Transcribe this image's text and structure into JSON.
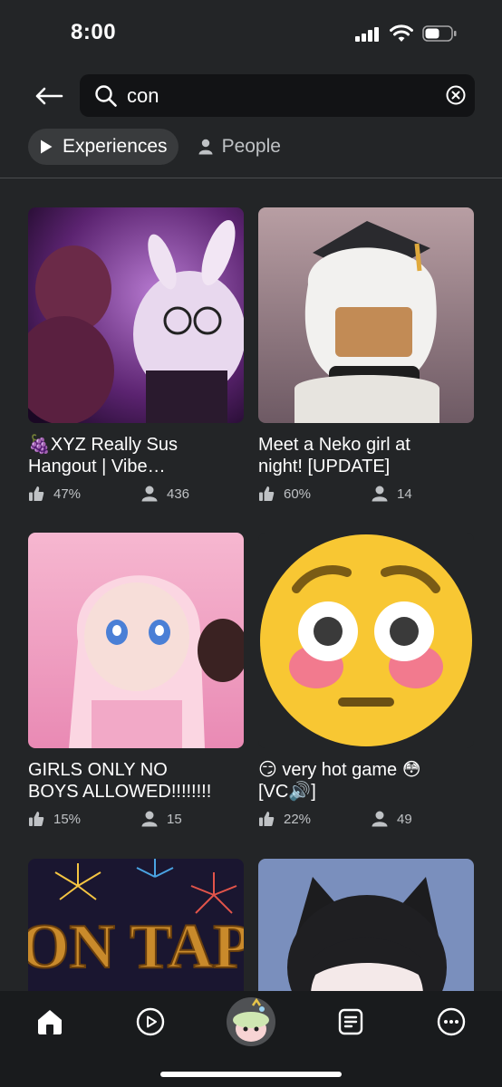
{
  "status_bar": {
    "time": "8:00",
    "icons": [
      "signal-icon",
      "wifi-icon",
      "battery-icon"
    ]
  },
  "search": {
    "value": "con",
    "back_icon": "arrow-left-icon",
    "search_icon": "search-icon",
    "clear_icon": "clear-icon"
  },
  "filters": [
    {
      "label": "Experiences",
      "icon": "play-icon",
      "active": true
    },
    {
      "label": "People",
      "icon": "person-icon",
      "active": false
    }
  ],
  "results": [
    {
      "title": "🍇XYZ Really Sus\nHangout | Vibe…",
      "rating": "47%",
      "players": "436",
      "thumbnail": "purple-bunny-avatar-thumbnail"
    },
    {
      "title": "Meet a Neko girl at\nnight! [UPDATE]",
      "rating": "60%",
      "players": "14",
      "thumbnail": "neko-girl-thumbnail"
    },
    {
      "title": "GIRLS ONLY NO\nBOYS ALLOWED!!!!!!!!",
      "rating": "15%",
      "players": "15",
      "thumbnail": "pink-avatar-thumbnail"
    },
    {
      "title": "😏 very hot game 😳\n[VC🔊]",
      "rating": "22%",
      "players": "49",
      "thumbnail": "flushed-emoji-thumbnail"
    },
    {
      "title": "",
      "rating": "",
      "players": "",
      "thumbnail": "fireworks-sign-thumbnail",
      "sign_text": "ON TAP"
    },
    {
      "title": "",
      "rating": "",
      "players": "",
      "thumbnail": "wolf-ears-avatar-thumbnail"
    }
  ],
  "bottom_nav": [
    {
      "name": "home",
      "icon": "home-icon",
      "active": true
    },
    {
      "name": "discover",
      "icon": "play-circle-icon",
      "active": false
    },
    {
      "name": "avatar",
      "icon": "avatar-icon",
      "active": false
    },
    {
      "name": "charts",
      "icon": "list-icon",
      "active": false
    },
    {
      "name": "more",
      "icon": "more-icon",
      "active": false
    }
  ],
  "colors": {
    "background": "#232527",
    "search_bg": "#121315",
    "chip_active": "#393b3d",
    "nav_bg": "#191b1d",
    "secondary_text": "#bfc2c5"
  }
}
